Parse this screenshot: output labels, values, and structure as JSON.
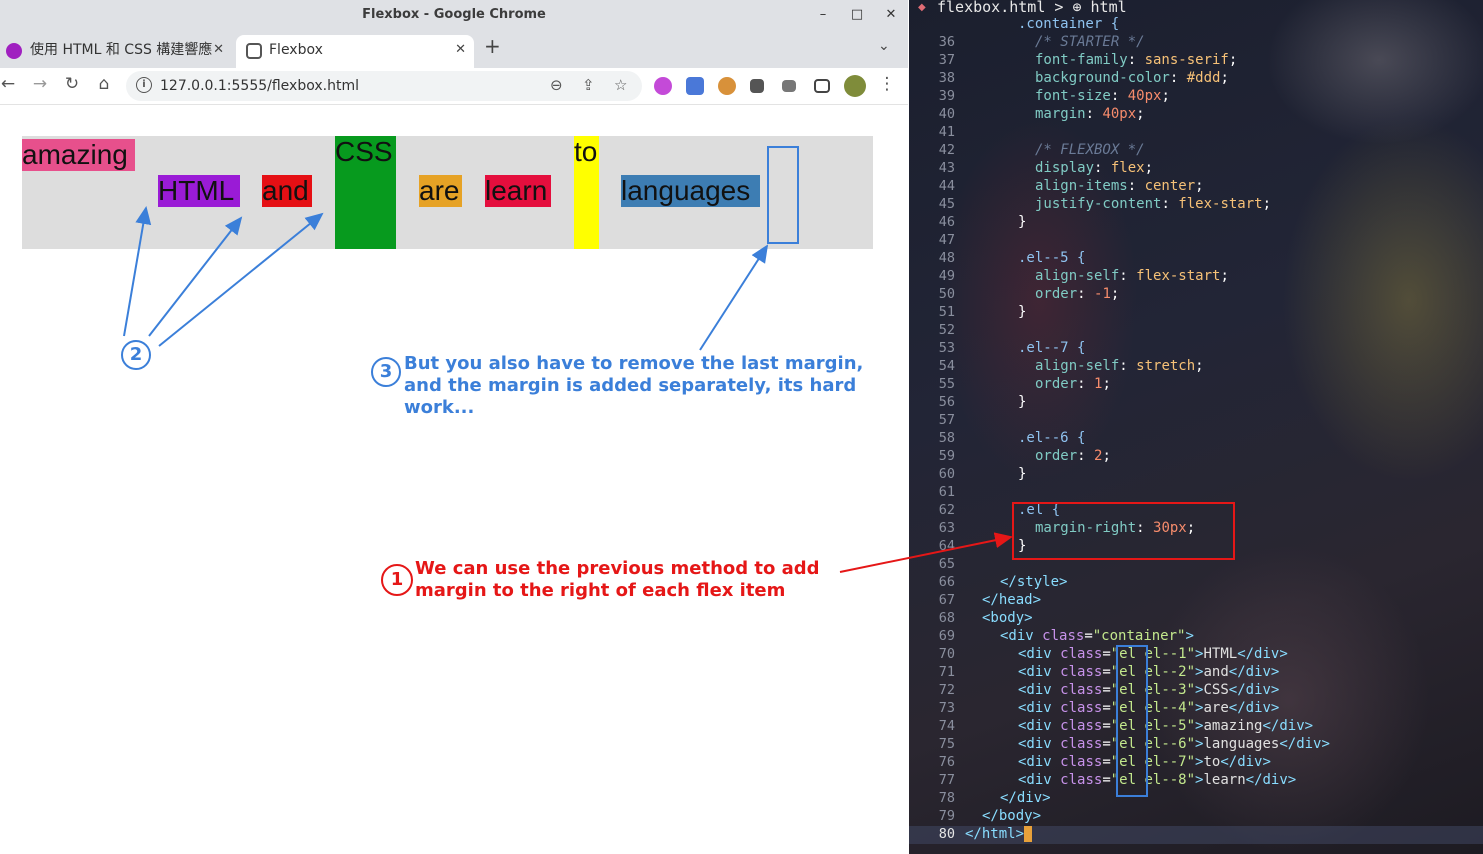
{
  "window": {
    "title": "Flexbox - Google Chrome",
    "controls": [
      "–",
      "□",
      "✕"
    ]
  },
  "tabs": [
    {
      "label": "使用 HTML 和 CSS 構建響應",
      "close": "✕"
    },
    {
      "label": "Flexbox",
      "close": "✕"
    }
  ],
  "new_tab": "+",
  "tab_menu": "⌄",
  "toolbar": {
    "back": "←",
    "forward": "→",
    "reload": "↻",
    "home": "⌂",
    "info": "i",
    "url": "127.0.0.1:5555/flexbox.html",
    "zoom": "⊖",
    "share": "⇪",
    "star": "☆",
    "menu": "⋮"
  },
  "flex_items": {
    "amazing": "amazing",
    "html": "HTML",
    "and": "and",
    "css": "CSS",
    "are": "are",
    "learn": "learn",
    "to": "to",
    "languages": "languages"
  },
  "colors": {
    "container": "#dddddd",
    "amazing": "#e7508c",
    "html": "#9a1bd6",
    "and": "#e50f14",
    "css": "#079a1e",
    "are": "#e6a225",
    "learn": "#e40e3d",
    "to": "#ffff00",
    "languages": "#3d7db3",
    "annotation_blue": "#3b7fd9",
    "annotation_red": "#e51717"
  },
  "annotations": {
    "num1": "1",
    "num2": "2",
    "num3": "3",
    "note1_line1": "We can use the previous method to add",
    "note1_line2": "margin to the right of each flex item",
    "note3_line1": "But you also have to remove the last margin,",
    "note3_line2": "and the margin is added separately, its hard",
    "note3_line3": "work..."
  },
  "editor": {
    "breadcrumb": "flexbox.html > ⊕ html",
    "line_numbers": [
      "36",
      "37",
      "38",
      "39",
      "40",
      "41",
      "42",
      "43",
      "44",
      "45",
      "46",
      "47",
      "48",
      "49",
      "50",
      "51",
      "52",
      "53",
      "54",
      "55",
      "56",
      "57",
      "58",
      "59",
      "60",
      "61",
      "62",
      "63",
      "64",
      "65",
      "66",
      "67",
      "68",
      "69",
      "70",
      "71",
      "72",
      "73",
      "74",
      "75",
      "76",
      "77",
      "78",
      "79",
      "80"
    ],
    "code": {
      "l35": ".container {",
      "l36": "/* STARTER */",
      "l37_p": "font-family",
      "l37_v": "sans-serif",
      "l38_p": "background-color",
      "l38_v": "#ddd",
      "l39_p": "font-size",
      "l39_v": "40px",
      "l40_p": "margin",
      "l40_v": "40px",
      "l42": "/* FLEXBOX */",
      "l43_p": "display",
      "l43_v": "flex",
      "l44_p": "align-items",
      "l44_v": "center",
      "l45_p": "justify-content",
      "l45_v": "flex-start",
      "close": "}",
      "l48": ".el--5 {",
      "l49_p": "align-self",
      "l49_v": "flex-start",
      "l50_p": "order",
      "l50_v": "-1",
      "l53": ".el--7 {",
      "l54_p": "align-self",
      "l54_v": "stretch",
      "l55_p": "order",
      "l55_v": "1",
      "l58": ".el--6 {",
      "l59_p": "order",
      "l59_v": "2",
      "l62": ".el {",
      "l63_p": "margin-right",
      "l63_v": "30px",
      "l66": "</style>",
      "l67": "</head>",
      "l68": "<body>",
      "l69_open": "<div ",
      "l69_attr": "class",
      "l69_str": "\"container\"",
      "l69_end": ">",
      "rows": [
        {
          "cls": "\"el el--1\"",
          "text": "HTML"
        },
        {
          "cls": "\"el el--2\"",
          "text": "and"
        },
        {
          "cls": "\"el el--3\"",
          "text": "CSS"
        },
        {
          "cls": "\"el el--4\"",
          "text": "are"
        },
        {
          "cls": "\"el el--5\"",
          "text": "amazing"
        },
        {
          "cls": "\"el el--6\"",
          "text": "languages"
        },
        {
          "cls": "\"el el--7\"",
          "text": "to"
        },
        {
          "cls": "\"el el--8\"",
          "text": "learn"
        }
      ],
      "l78": "</div>",
      "l79": "</body>",
      "l80": "</html>"
    }
  }
}
